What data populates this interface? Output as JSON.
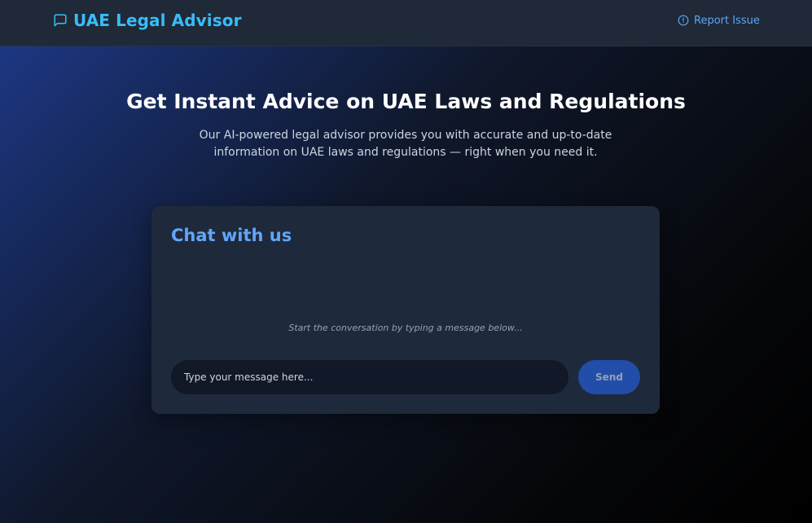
{
  "header": {
    "brand_icon": "chat-bubble-icon",
    "brand_title": "UAE Legal Advisor",
    "report_icon": "alert-circle-icon",
    "report_label": "Report Issue"
  },
  "hero": {
    "title": "Get Instant Advice on UAE Laws and Regulations",
    "subtitle": "Our AI-powered legal advisor provides you with accurate and up-to-date information on UAE laws and regulations — right when you need it."
  },
  "chat": {
    "title": "Chat with us",
    "empty_state": "Start the conversation by typing a message below...",
    "input_placeholder": "Type your message here...",
    "input_value": "",
    "send_label": "Send"
  },
  "colors": {
    "brand_accent": "#38bdf8",
    "link_accent": "#60a5fa",
    "card_background": "#1e293b",
    "navbar_background": "#1f2937",
    "send_button": "#2563eb"
  }
}
